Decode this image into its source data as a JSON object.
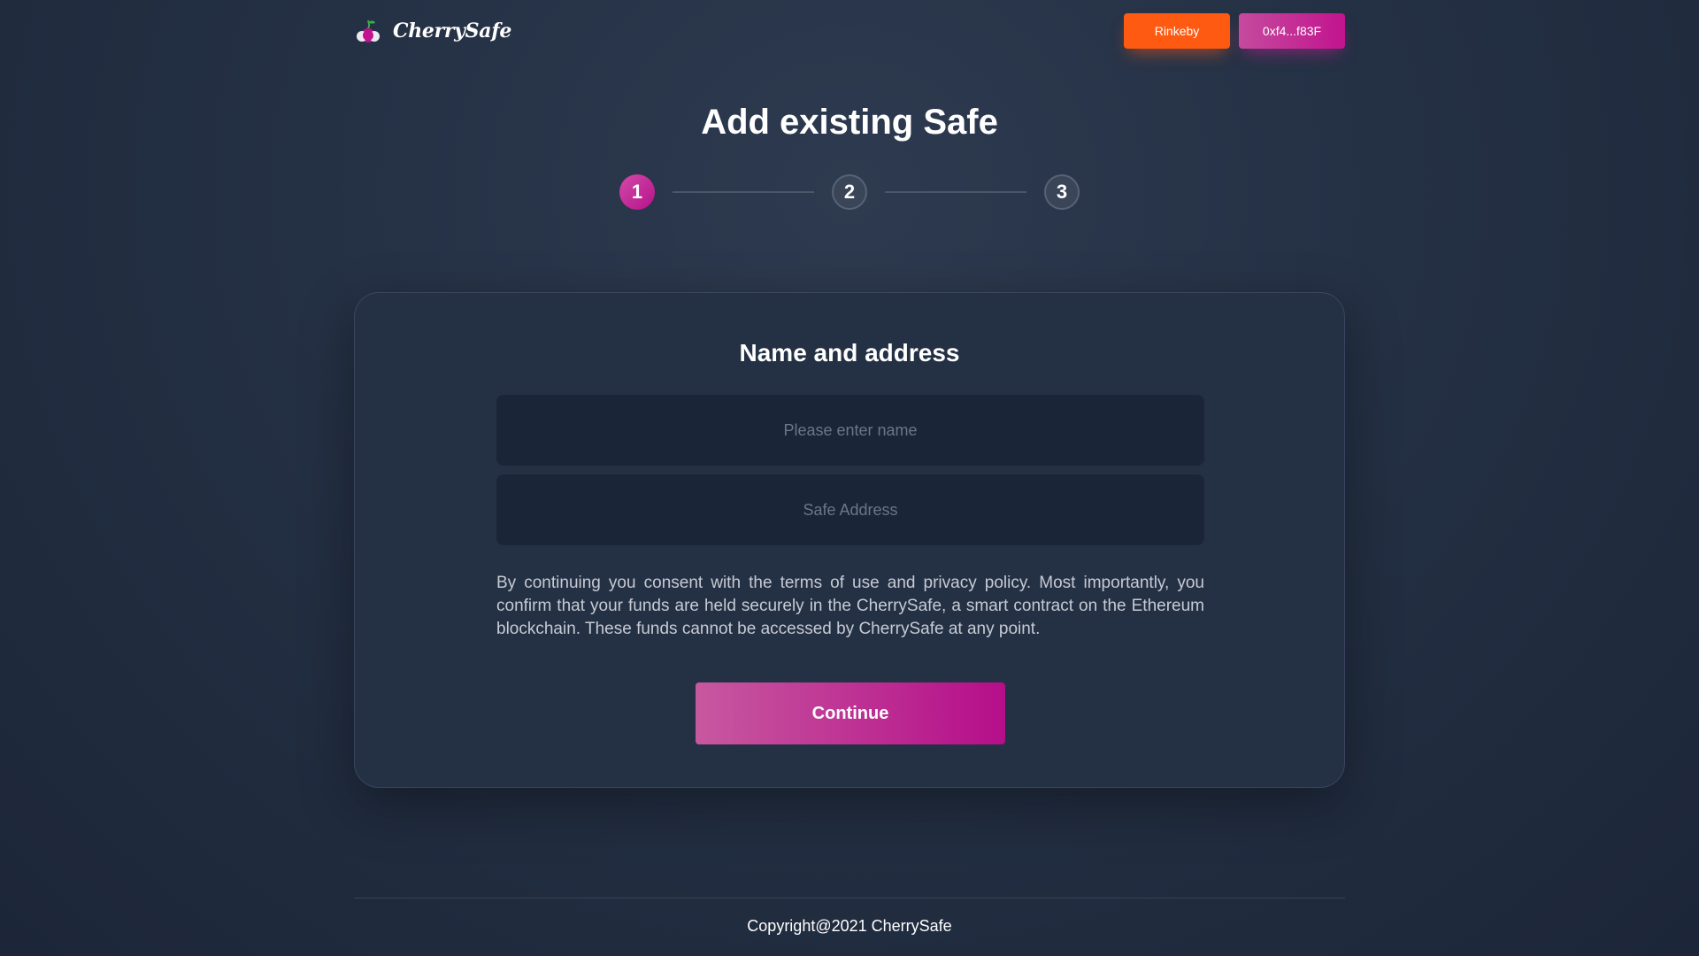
{
  "header": {
    "brand": "CherrySafe",
    "logo_icon": "cherry-icon",
    "network_label": "Rinkeby",
    "account_label": "0xf4...f83F"
  },
  "page": {
    "title": "Add existing Safe"
  },
  "stepper": {
    "steps": [
      "1",
      "2",
      "3"
    ],
    "active_step": 1
  },
  "card": {
    "title": "Name and address",
    "name_input": {
      "value": "",
      "placeholder": "Please enter name"
    },
    "address_input": {
      "value": "",
      "placeholder": "Safe Address"
    },
    "consent_text": "By continuing you consent with the terms of use and privacy policy. Most importantly, you confirm that your funds are held securely in the CherrySafe, a smart contract on the Ethereum blockchain. These funds cannot be accessed by CherrySafe at any point.",
    "continue_label": "Continue"
  },
  "footer": {
    "copyright": "Copyright@2021 CherrySafe"
  },
  "colors": {
    "accent_pink": "#c2148e",
    "network_orange": "#ff5a12",
    "background": "#243044",
    "card": "#243044",
    "input": "#1a2538"
  }
}
